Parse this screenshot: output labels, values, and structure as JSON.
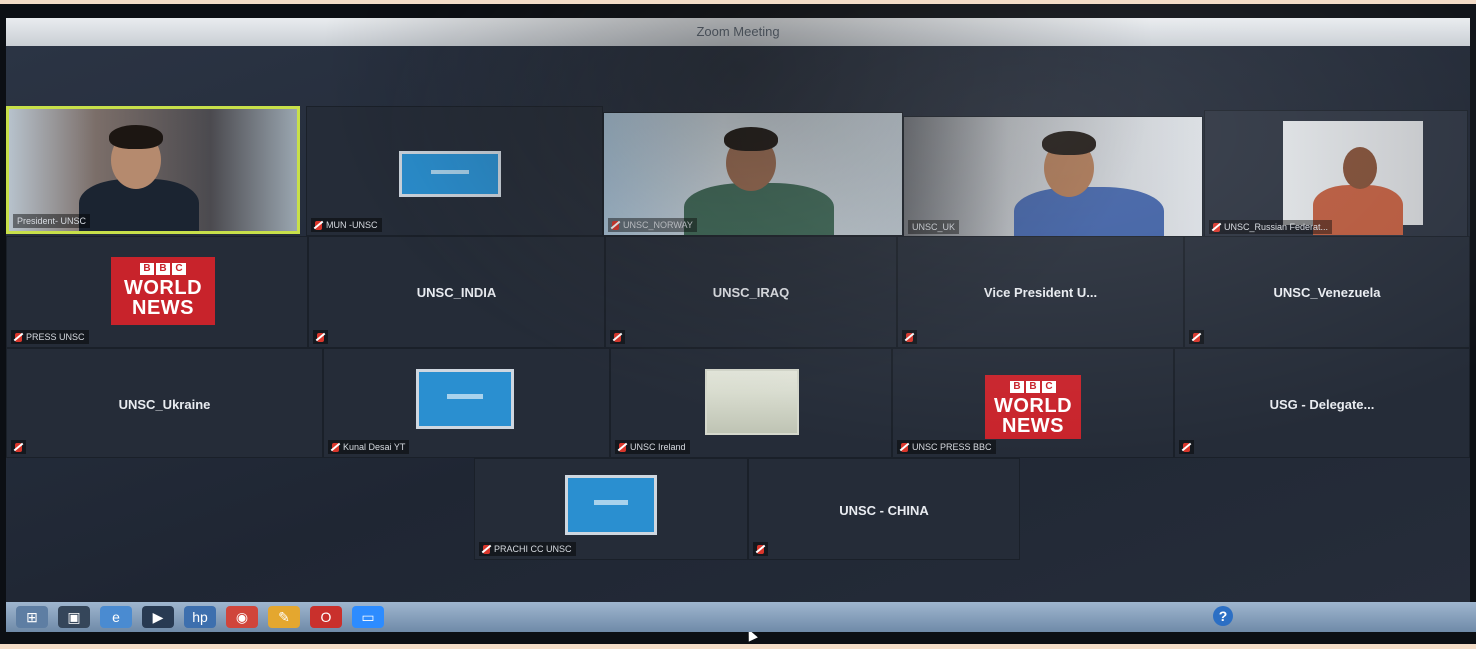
{
  "window": {
    "title": "Zoom Meeting"
  },
  "participants": [
    {
      "name": "President- UNSC",
      "center_label": "",
      "type": "video"
    },
    {
      "name": "MUN -UNSC",
      "center_label": "",
      "type": "screen"
    },
    {
      "name": "UNSC_NORWAY",
      "center_label": "",
      "type": "video"
    },
    {
      "name": "UNSC_UK",
      "center_label": "",
      "type": "video"
    },
    {
      "name": "UNSC_Russian Federat...",
      "center_label": "",
      "type": "video"
    },
    {
      "name": "PRESS UNSC",
      "center_label": "",
      "type": "bbc"
    },
    {
      "name": "",
      "center_label": "UNSC_INDIA",
      "type": "name"
    },
    {
      "name": "",
      "center_label": "UNSC_IRAQ",
      "type": "name"
    },
    {
      "name": "",
      "center_label": "Vice President U...",
      "type": "name"
    },
    {
      "name": "",
      "center_label": "UNSC_Venezuela",
      "type": "name"
    },
    {
      "name": "",
      "center_label": "UNSC_Ukraine",
      "type": "name"
    },
    {
      "name": "Kunal Desai YT",
      "center_label": "",
      "type": "screen"
    },
    {
      "name": "UNSC Ireland",
      "center_label": "",
      "type": "image"
    },
    {
      "name": "UNSC PRESS BBC",
      "center_label": "",
      "type": "bbc"
    },
    {
      "name": "",
      "center_label": "USG - Delegate...",
      "type": "name"
    },
    {
      "name": "PRACHI CC UNSC",
      "center_label": "",
      "type": "screen"
    },
    {
      "name": "",
      "center_label": "UNSC - CHINA",
      "type": "name"
    }
  ],
  "bbc_logo": {
    "letters": [
      "B",
      "B",
      "C"
    ],
    "line1": "WORLD",
    "line2": "NEWS"
  },
  "taskbar": {
    "help_glyph": "?"
  },
  "colors": {
    "active_speaker_border": "#c8e04a",
    "muted_mic": "#d9362b",
    "bbc_red": "#c8232b"
  }
}
